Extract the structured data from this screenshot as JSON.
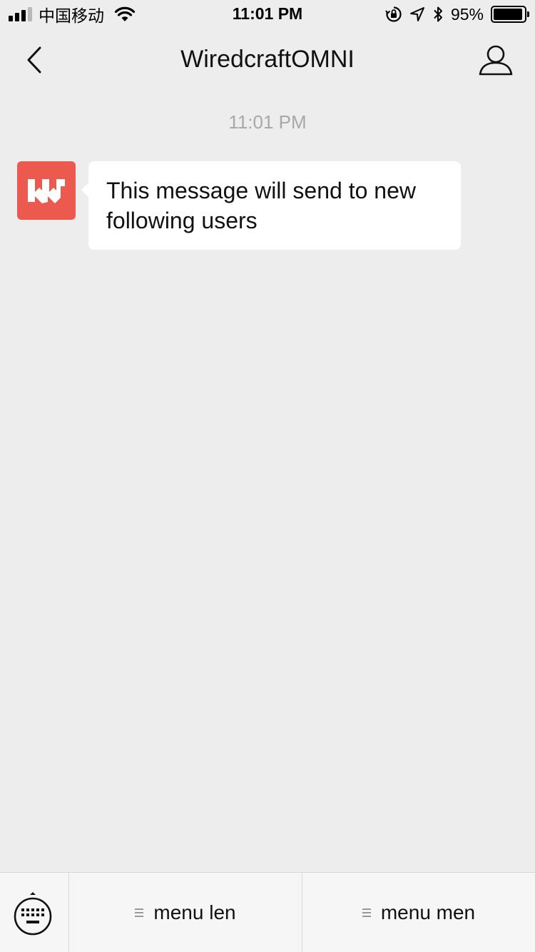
{
  "status_bar": {
    "carrier": "中国移动",
    "time": "11:01 PM",
    "battery_percent": "95%",
    "battery_level": 0.95,
    "icons": [
      "signal-icon",
      "wifi-icon",
      "orientation-lock-icon",
      "location-icon",
      "bluetooth-icon",
      "battery-icon"
    ]
  },
  "nav": {
    "title": "WiredcraftOMNI"
  },
  "chat": {
    "timestamp": "11:01 PM",
    "messages": [
      {
        "sender": "WiredcraftOMNI",
        "text": "This message will send to new following users"
      }
    ]
  },
  "bottom_menu": {
    "items": [
      {
        "label": "menu len"
      },
      {
        "label": "menu men"
      }
    ]
  },
  "colors": {
    "background": "#ededed",
    "avatar": "#ec5a4f",
    "bubble": "#ffffff",
    "timestamp": "#a8a8a8"
  }
}
